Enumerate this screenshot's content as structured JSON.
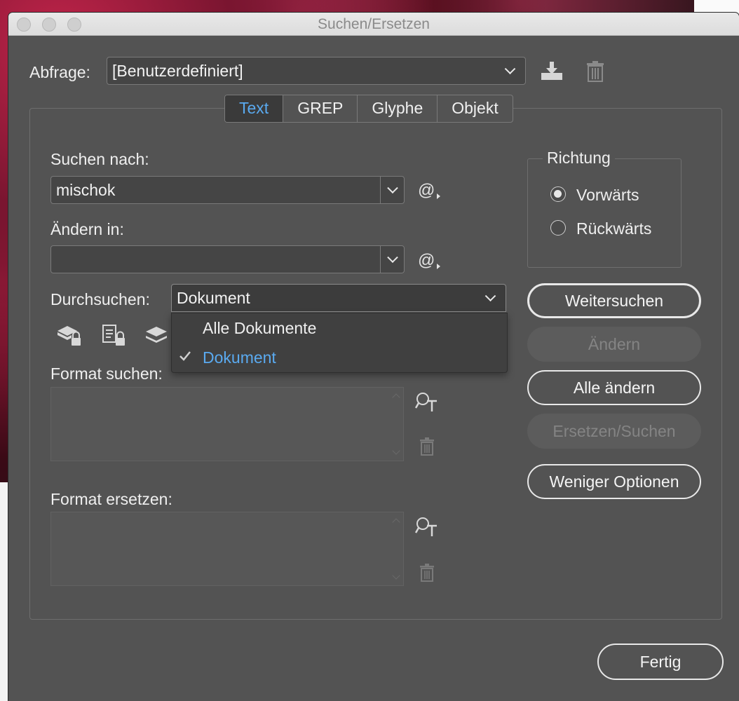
{
  "window": {
    "title": "Suchen/Ersetzen"
  },
  "query": {
    "label": "Abfrage:",
    "value": "[Benutzerdefiniert]"
  },
  "tabs": [
    {
      "label": "Text",
      "active": true
    },
    {
      "label": "GREP",
      "active": false
    },
    {
      "label": "Glyphe",
      "active": false
    },
    {
      "label": "Objekt",
      "active": false
    }
  ],
  "search": {
    "label": "Suchen nach:",
    "value": "mischok"
  },
  "replace": {
    "label": "Ändern in:",
    "value": ""
  },
  "scope": {
    "label": "Durchsuchen:",
    "value": "Dokument",
    "options": [
      {
        "label": "Alle Dokumente",
        "selected": false
      },
      {
        "label": "Dokument",
        "selected": true
      }
    ]
  },
  "format_search": {
    "label": "Format suchen:"
  },
  "format_replace": {
    "label": "Format ersetzen:"
  },
  "direction": {
    "title": "Richtung",
    "options": [
      {
        "label": "Vorwärts",
        "checked": true
      },
      {
        "label": "Rückwärts",
        "checked": false
      }
    ]
  },
  "buttons": {
    "find_next": "Weitersuchen",
    "change": "Ändern",
    "change_all": "Alle ändern",
    "replace_find": "Ersetzen/Suchen",
    "fewer_options": "Weniger Optionen",
    "done": "Fertig"
  },
  "colors": {
    "accent": "#5aaaf0",
    "dialog_bg": "#535353"
  }
}
